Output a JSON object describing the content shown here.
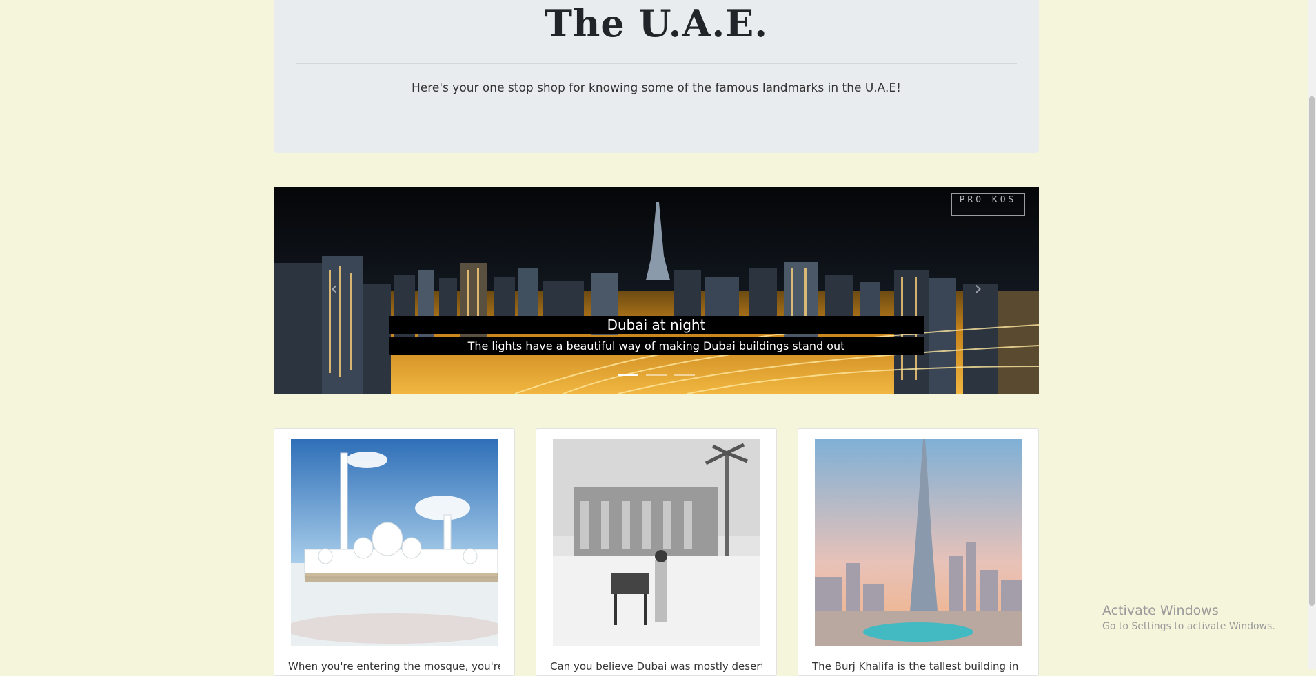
{
  "header": {
    "title": "The U.A.E.",
    "lead": "Here's your one stop shop for knowing some of the famous landmarks in the U.A.E!"
  },
  "carousel": {
    "slide_title": "Dubai at night",
    "slide_caption": "The lights have a beautiful way of making Dubai buildings stand out",
    "watermark": "PRO KOS",
    "prev_icon": "chevron-left-icon",
    "next_icon": "chevron-right-icon",
    "indicator_count": 3,
    "active_indicator": 1
  },
  "cards": [
    {
      "image": "grand-mosque-photo",
      "text": "When you're entering the mosque, you're"
    },
    {
      "image": "old-dubai-desert-photo",
      "text": "Can you believe Dubai was mostly desert"
    },
    {
      "image": "burj-khalifa-photo",
      "text": "The Burj Khalifa is the tallest building in"
    }
  ],
  "os_notice": {
    "title": "Activate Windows",
    "subtitle": "Go to Settings to activate Windows."
  },
  "colors": {
    "page_bg": "#f5f5dc",
    "jumbotron_bg": "#e9ecef",
    "caption_bg": "#000000"
  }
}
